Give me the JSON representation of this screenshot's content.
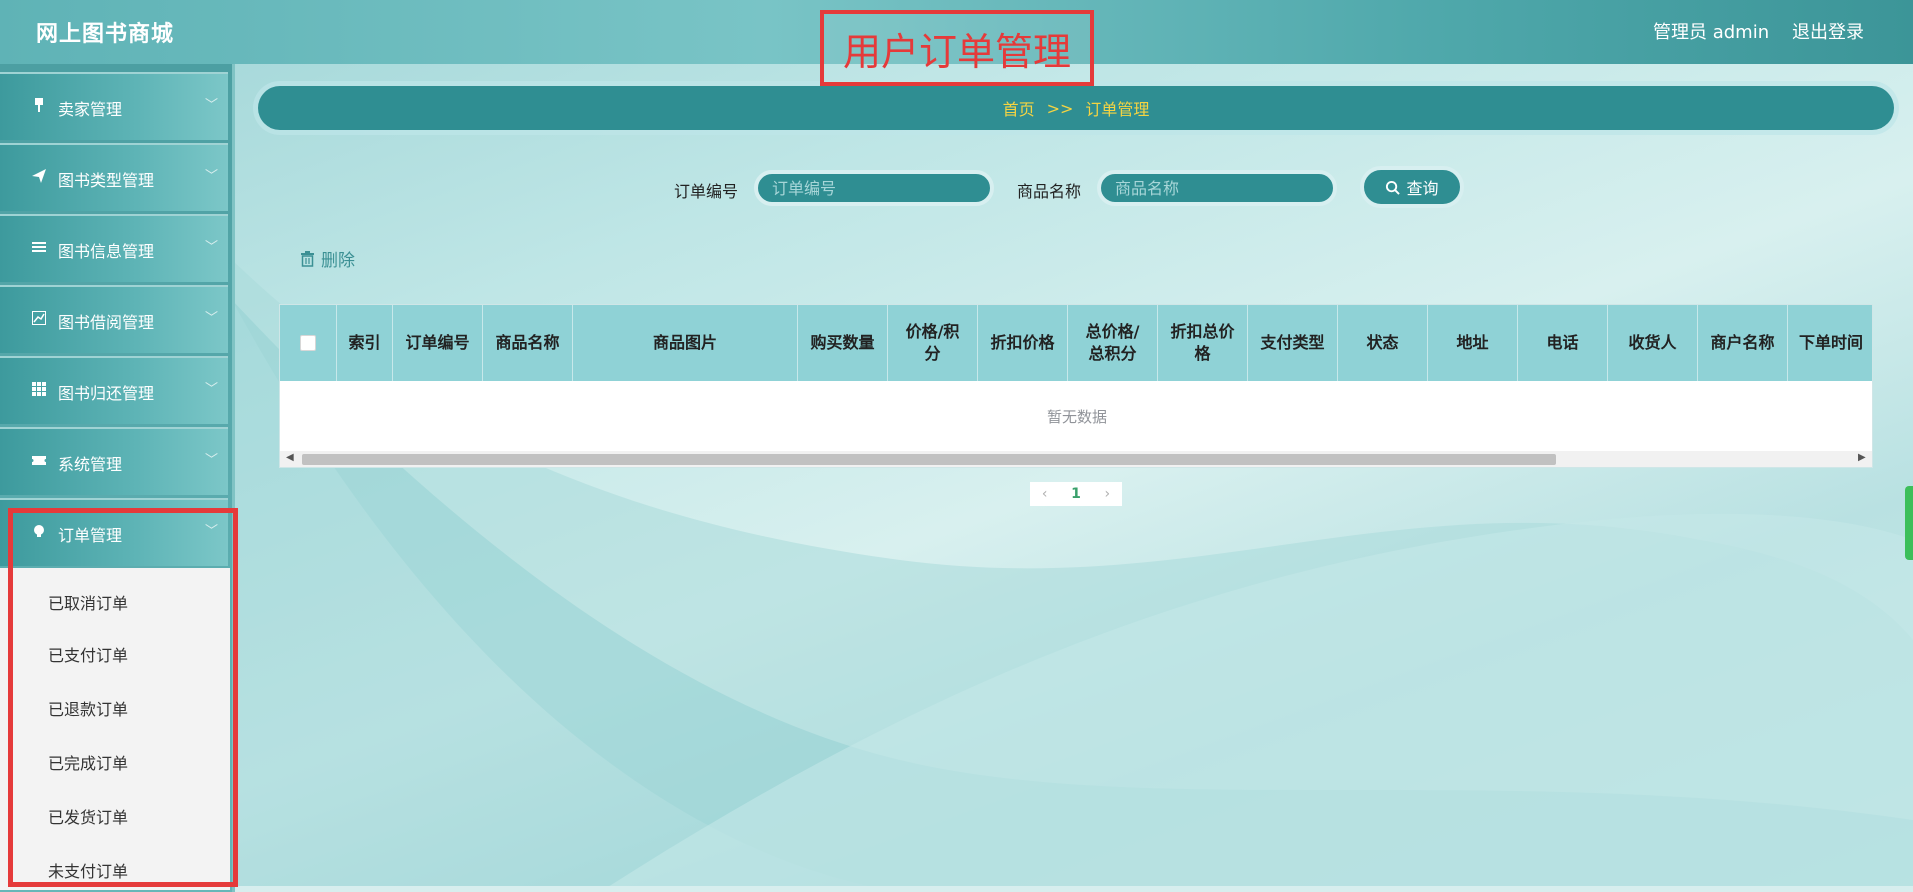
{
  "app": {
    "brand": "网上图书商城",
    "admin_label": "管理员 admin",
    "logout_label": "退出登录"
  },
  "overlay_title": "用户订单管理",
  "sidebar": {
    "items": [
      {
        "label": "卖家管理",
        "icon": "stand-icon"
      },
      {
        "label": "图书类型管理",
        "icon": "paper-plane-icon"
      },
      {
        "label": "图书信息管理",
        "icon": "list-icon"
      },
      {
        "label": "图书借阅管理",
        "icon": "chart-icon"
      },
      {
        "label": "图书归还管理",
        "icon": "grid-icon"
      },
      {
        "label": "系统管理",
        "icon": "ticket-icon"
      },
      {
        "label": "订单管理",
        "icon": "bulb-icon"
      }
    ],
    "submenu": [
      "已取消订单",
      "已支付订单",
      "已退款订单",
      "已完成订单",
      "已发货订单",
      "未支付订单"
    ]
  },
  "breadcrumb": {
    "home": "首页",
    "separator": ">>",
    "current": "订单管理"
  },
  "search": {
    "order_no_label": "订单编号",
    "order_no_placeholder": "订单编号",
    "product_label": "商品名称",
    "product_placeholder": "商品名称",
    "button_label": "查询"
  },
  "actions": {
    "delete_label": "删除"
  },
  "table": {
    "headers": [
      "索引",
      "订单编号",
      "商品名称",
      "商品图片",
      "购买数量",
      "价格/积分",
      "折扣价格",
      "总价格/总积分",
      "折扣总价格",
      "支付类型",
      "状态",
      "地址",
      "电话",
      "收货人",
      "商户名称",
      "下单时间"
    ],
    "empty_text": "暂无数据"
  },
  "pagination": {
    "current_page": "1"
  },
  "colors": {
    "primary": "#2f8e92",
    "highlight": "#e53a3a",
    "breadcrumb_text": "#f5d442"
  }
}
